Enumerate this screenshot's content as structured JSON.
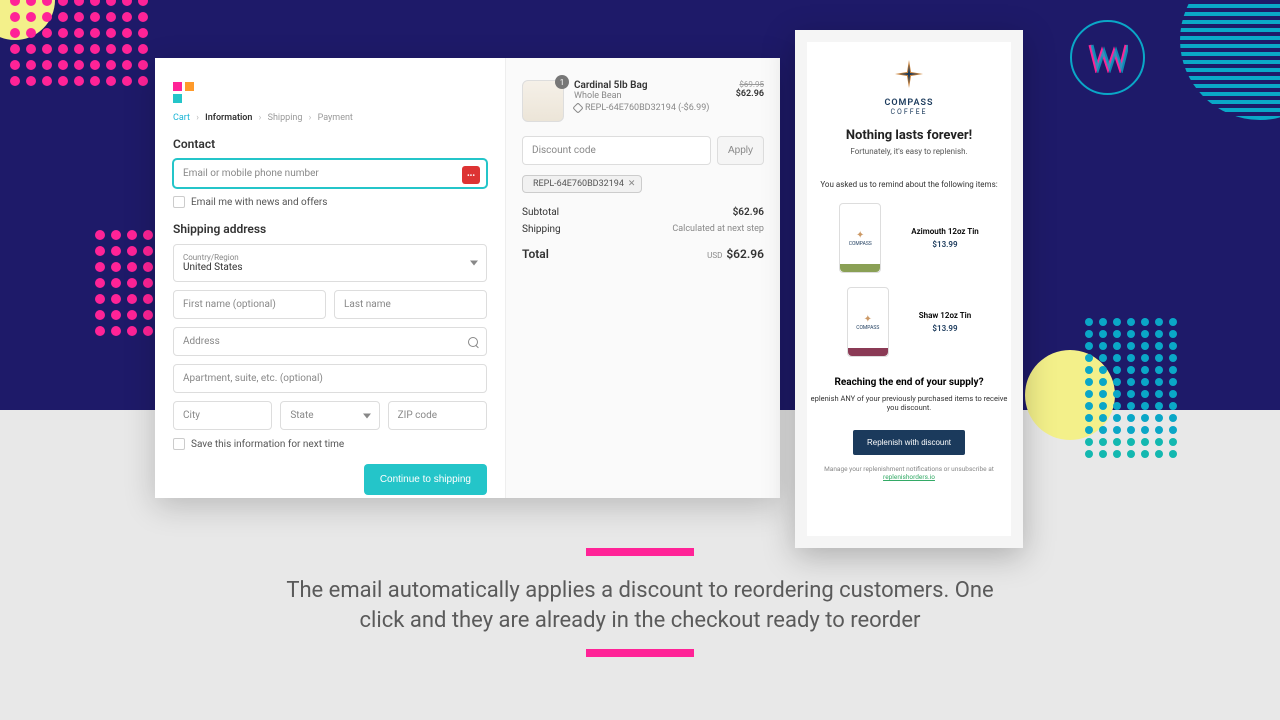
{
  "checkout": {
    "breadcrumbs": {
      "cart": "Cart",
      "info": "Information",
      "shipping": "Shipping",
      "payment": "Payment"
    },
    "contact": {
      "heading": "Contact",
      "email_placeholder": "Email or mobile phone number",
      "newsletter_label": "Email me with news and offers"
    },
    "shipping": {
      "heading": "Shipping address",
      "country_label": "Country/Region",
      "country_value": "United States",
      "first_name": "First name (optional)",
      "last_name": "Last name",
      "address": "Address",
      "apartment": "Apartment, suite, etc. (optional)",
      "city": "City",
      "state": "State",
      "zip": "ZIP code",
      "save_label": "Save this information for next time"
    },
    "cta": "Continue to shipping",
    "order": {
      "product_name": "Cardinal 5lb Bag",
      "product_variant": "Whole Bean",
      "product_discount_tag": "REPL-64E760BD32194 (-$6.99)",
      "qty": "1",
      "price_was": "$69.95",
      "price_now": "$62.96",
      "discount_placeholder": "Discount code",
      "apply": "Apply",
      "applied_code": "REPL-64E760BD32194",
      "subtotal_label": "Subtotal",
      "subtotal_val": "$62.96",
      "shipping_label": "Shipping",
      "shipping_val": "Calculated at next step",
      "total_label": "Total",
      "total_currency": "USD",
      "total_val": "$62.96"
    }
  },
  "email": {
    "brand": "COMPASS",
    "brand_sub": "COFFEE",
    "headline": "Nothing lasts forever!",
    "subhead": "Fortunately, it's easy to replenish.",
    "reminder": "You asked us to remind about the following items:",
    "products": [
      {
        "name": "Azimouth 12oz Tin",
        "price": "$13.99",
        "band": "#8aa055"
      },
      {
        "name": "Shaw 12oz Tin",
        "price": "$13.99",
        "band": "#8a3a55"
      }
    ],
    "question": "Reaching the end of your supply?",
    "body": "eplenish ANY of your previously purchased items to receive you discount.",
    "button": "Replenish with discount",
    "footer_pre": "Manage your replenishment notifications or unsubscribe at ",
    "footer_link": "replenishorders.io"
  },
  "caption": "The email automatically applies a discount to reordering customers. One click and they are already in the checkout ready to reorder"
}
